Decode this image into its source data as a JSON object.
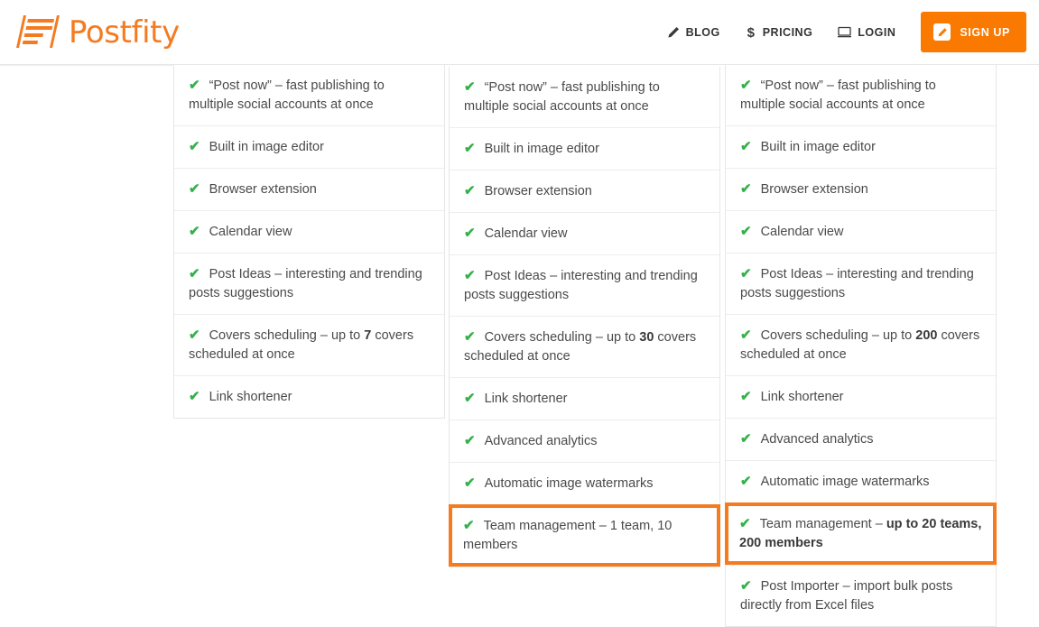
{
  "brand": {
    "name": "Postfity",
    "logo_icon": "postfity-bars-logo",
    "accent_color": "#f47b20",
    "button_color": "#fa7900",
    "check_color": "#35b14a"
  },
  "header": {
    "nav": [
      {
        "label": "BLOG",
        "icon": "pencil-icon",
        "name": "nav-blog"
      },
      {
        "label": "PRICING",
        "icon": "dollar-icon",
        "name": "nav-pricing"
      },
      {
        "label": "LOGIN",
        "icon": "monitor-icon",
        "name": "nav-login"
      }
    ],
    "signup": {
      "label": "SIGN UP",
      "icon": "compose-icon"
    }
  },
  "plans": [
    {
      "id": "plan-basic",
      "features": [
        {
          "text": "“Post now” – fast publishing to multiple social accounts at once",
          "highlight": false
        },
        {
          "text": "Built in image editor",
          "highlight": false
        },
        {
          "text": "Browser extension",
          "highlight": false
        },
        {
          "text": "Calendar view",
          "highlight": false
        },
        {
          "text": "Post Ideas – interesting and trending posts suggestions",
          "highlight": false
        },
        {
          "text": "Covers scheduling – up to <b>7</b> covers scheduled at once",
          "highlight": false
        },
        {
          "text": "Link shortener",
          "highlight": false
        }
      ]
    },
    {
      "id": "plan-pro",
      "features": [
        {
          "text": "“Post now” – fast publishing to multiple social accounts at once",
          "highlight": false
        },
        {
          "text": "Built in image editor",
          "highlight": false
        },
        {
          "text": "Browser extension",
          "highlight": false
        },
        {
          "text": "Calendar view",
          "highlight": false
        },
        {
          "text": "Post Ideas – interesting and trending posts suggestions",
          "highlight": false
        },
        {
          "text": "Covers scheduling – up to <b>30</b> covers scheduled at once",
          "highlight": false
        },
        {
          "text": "Link shortener",
          "highlight": false
        },
        {
          "text": "Advanced analytics",
          "highlight": false
        },
        {
          "text": "Automatic image watermarks",
          "highlight": false
        },
        {
          "text": "Team management – 1 team, 10 members",
          "highlight": true
        }
      ]
    },
    {
      "id": "plan-business",
      "features": [
        {
          "text": "“Post now” – fast publishing to multiple social accounts at once",
          "highlight": false
        },
        {
          "text": "Built in image editor",
          "highlight": false
        },
        {
          "text": "Browser extension",
          "highlight": false
        },
        {
          "text": "Calendar view",
          "highlight": false
        },
        {
          "text": "Post Ideas – interesting and trending posts suggestions",
          "highlight": false
        },
        {
          "text": "Covers scheduling – up to <b>200</b> covers scheduled at once",
          "highlight": false
        },
        {
          "text": "Link shortener",
          "highlight": false
        },
        {
          "text": "Advanced analytics",
          "highlight": false
        },
        {
          "text": "Automatic image watermarks",
          "highlight": false
        },
        {
          "text": "Team management – <b>up to 20 teams, 200 members</b>",
          "highlight": true
        },
        {
          "text": "Post Importer – import bulk posts directly from Excel files",
          "highlight": false
        }
      ]
    }
  ],
  "check_glyph": "✔"
}
